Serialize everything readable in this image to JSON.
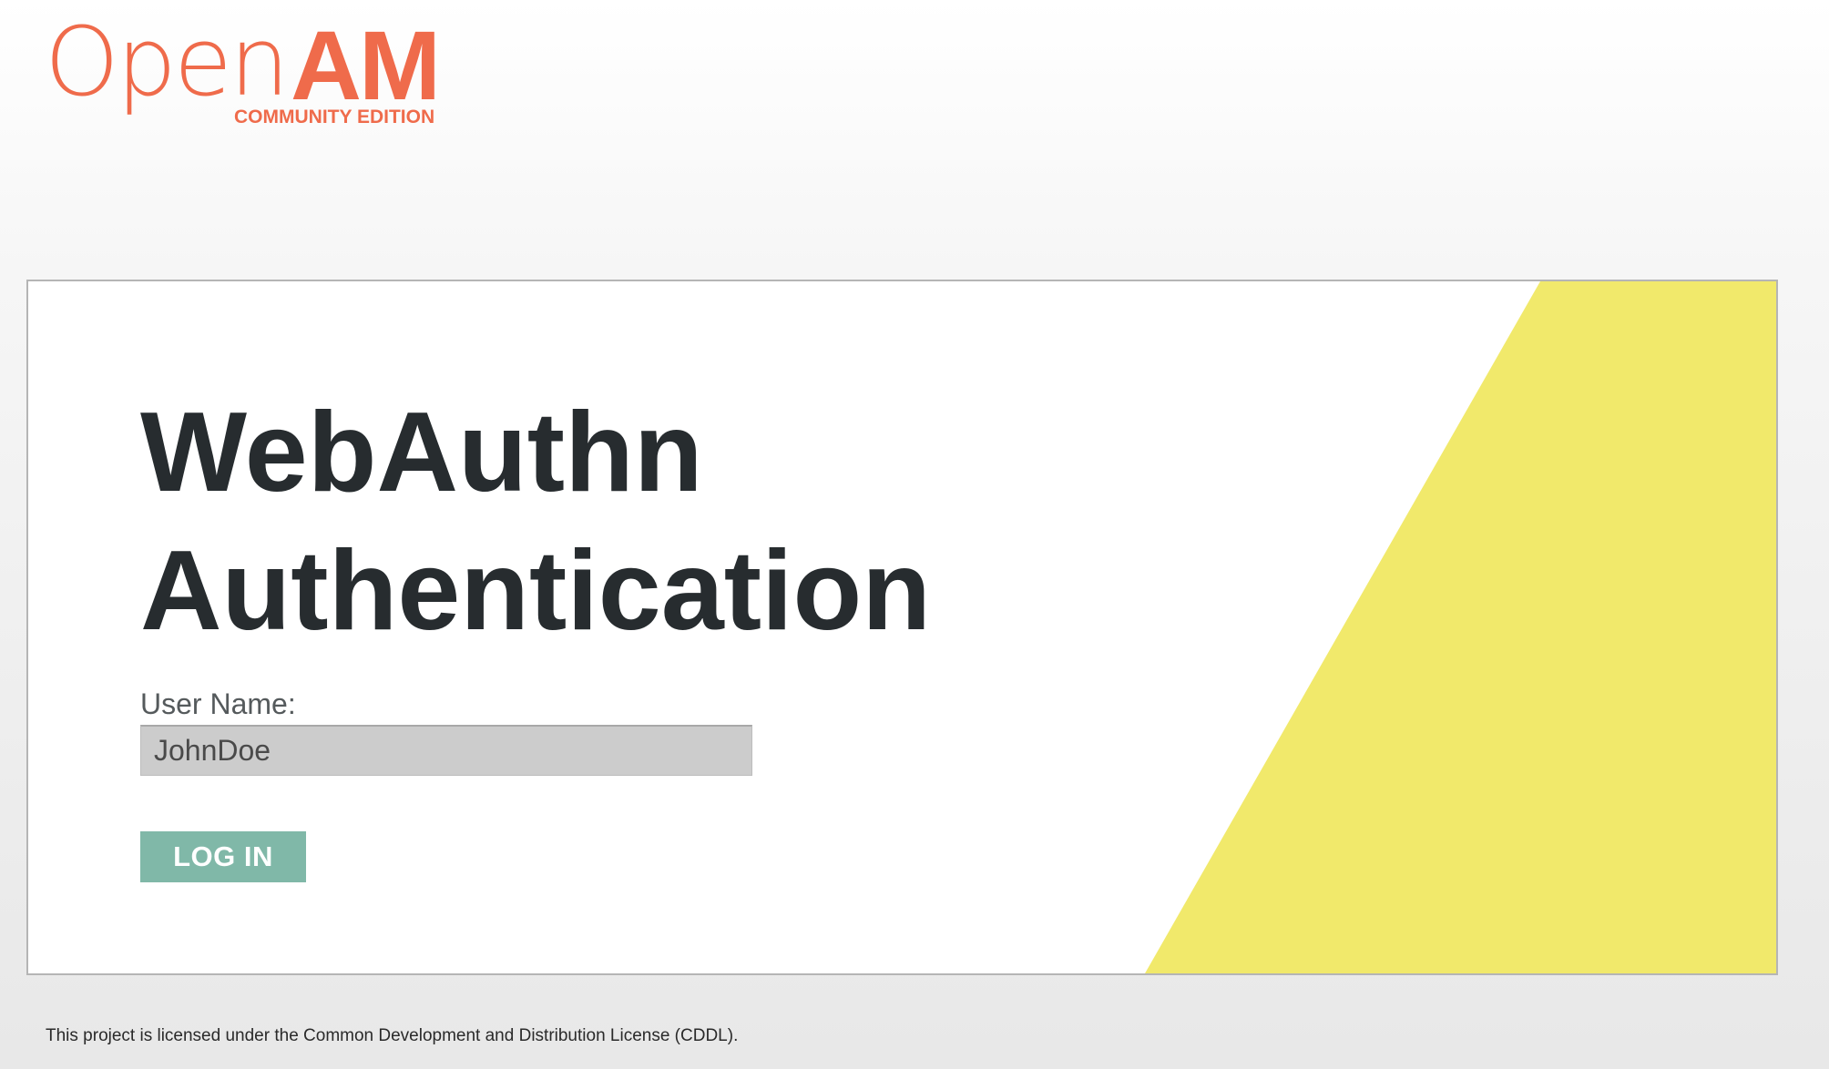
{
  "logo": {
    "open": "Open",
    "am": "AM",
    "edition": "COMMUNITY EDITION"
  },
  "login": {
    "title_line1": "WebAuthn",
    "title_line2": "Authentication",
    "username_label": "User Name:",
    "username_value": "JohnDoe",
    "login_button": "LOG IN"
  },
  "footer": {
    "license_text": "This project is licensed under the Common Development and Distribution License (CDDL)."
  },
  "colors": {
    "brand": "#ef6b4b",
    "accent_yellow": "#f1e96b",
    "button": "#80b8a8",
    "title": "#272c2f"
  }
}
